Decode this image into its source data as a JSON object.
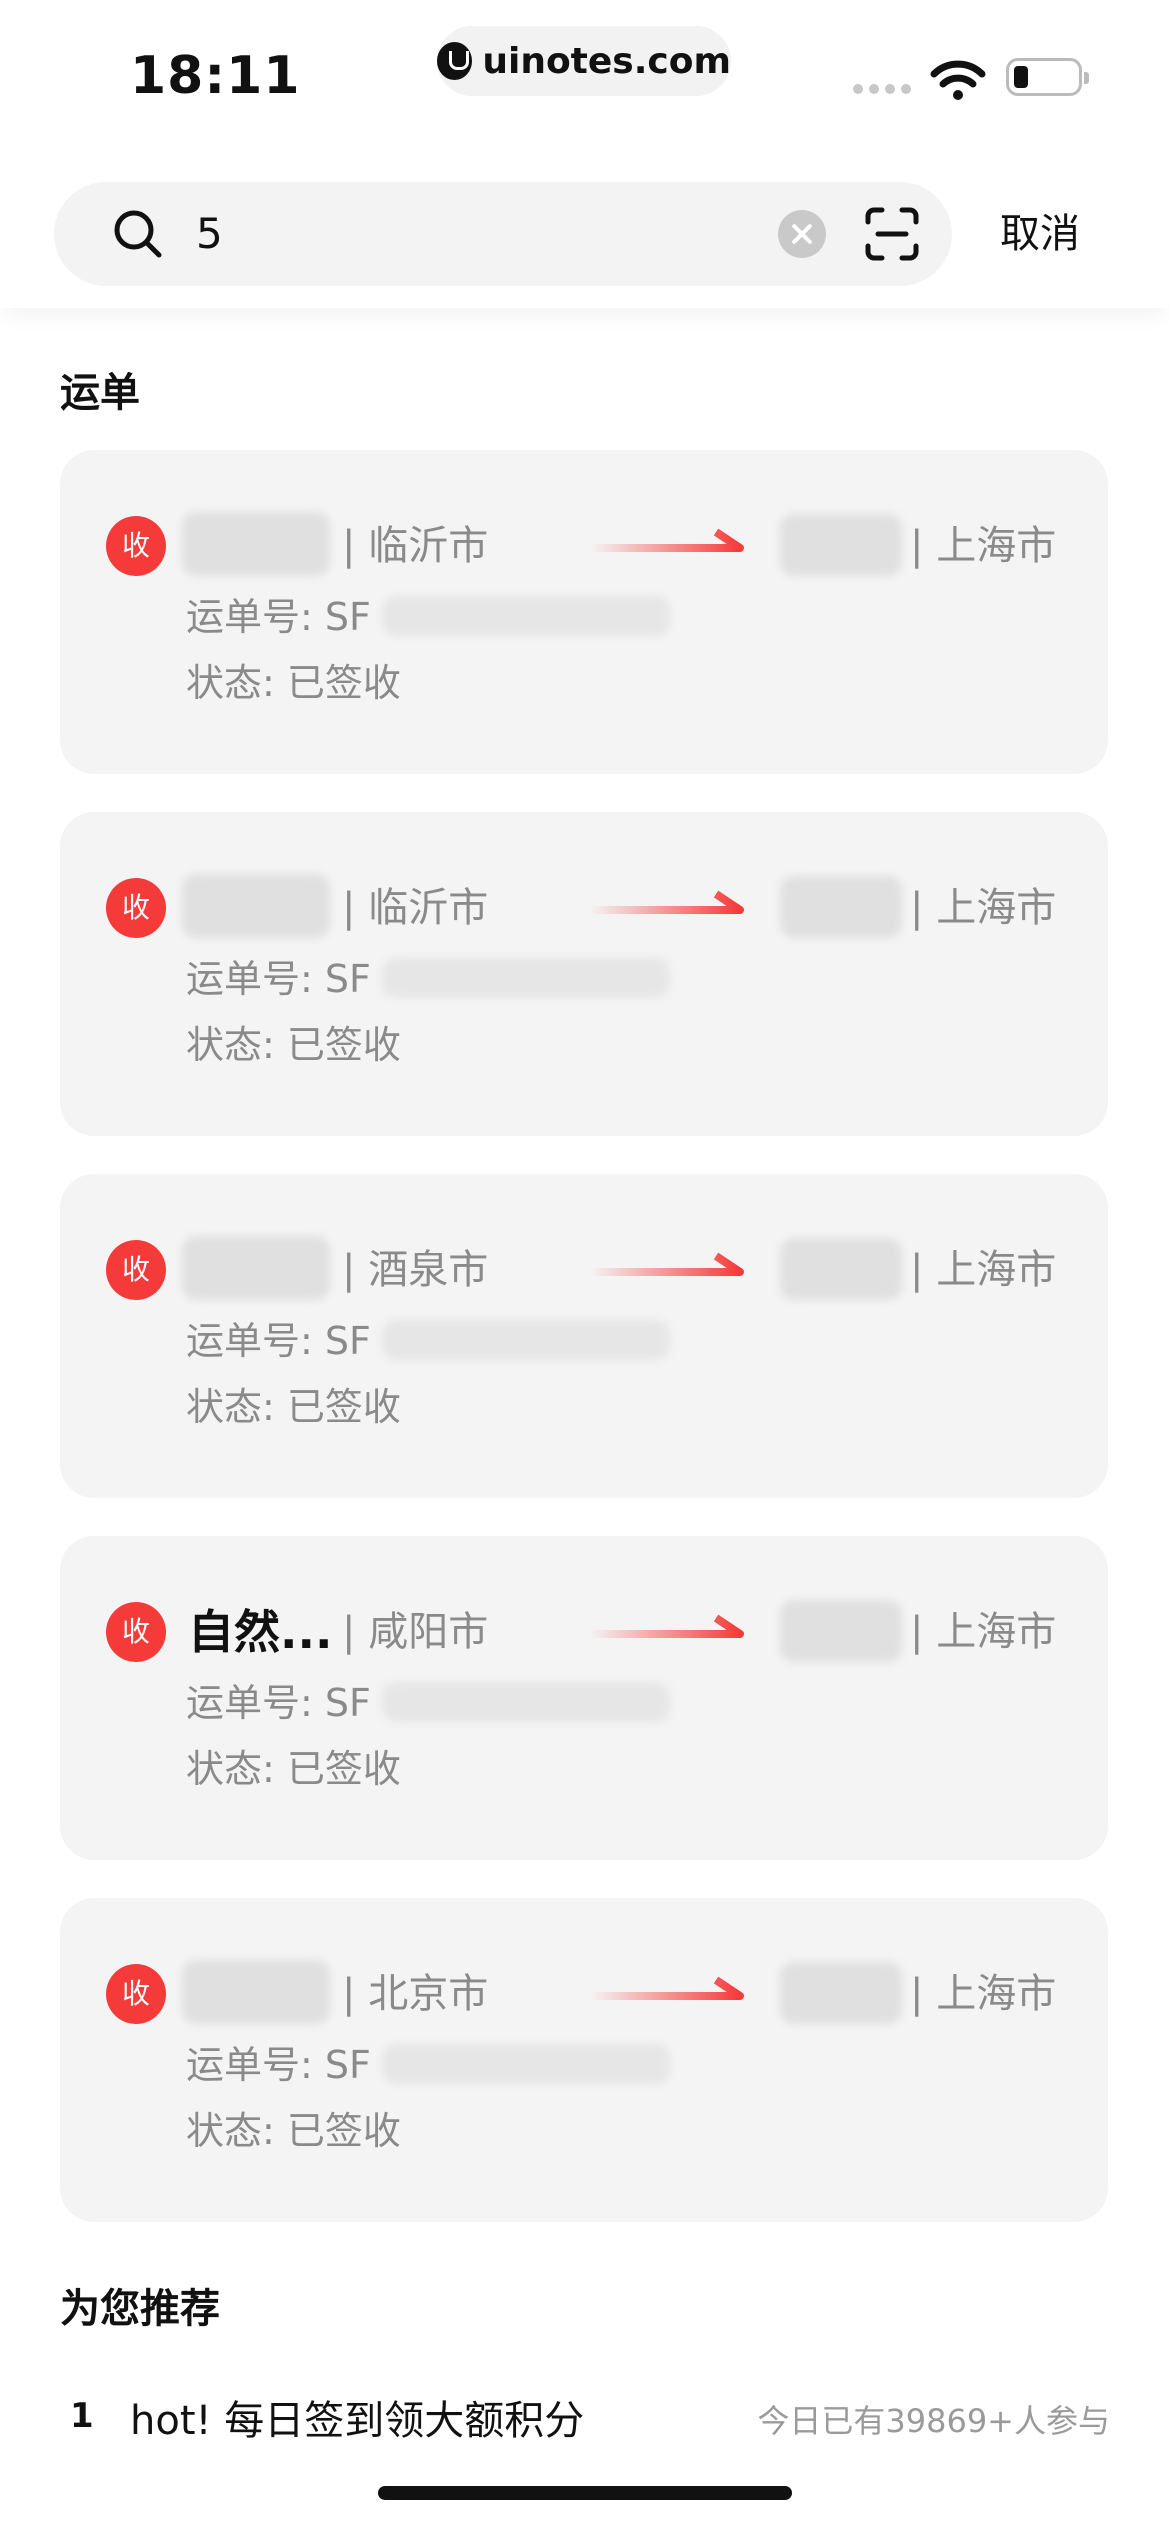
{
  "status_bar": {
    "time": "18:11",
    "url": "uinotes.com"
  },
  "search": {
    "query": "5",
    "cancel_label": "取消"
  },
  "sections": {
    "waybill_title": "运单",
    "recommend_title": "为您推荐"
  },
  "waybills": [
    {
      "badge": "收",
      "sender_name": "",
      "sender_city": "| 临沂市",
      "receiver_city": "| 上海市",
      "waybill_no": "运单号: SF",
      "status": "状态:  已签收"
    },
    {
      "badge": "收",
      "sender_name": "",
      "sender_city": "| 临沂市",
      "receiver_city": "| 上海市",
      "waybill_no": "运单号: SF",
      "status": "状态:  已签收"
    },
    {
      "badge": "收",
      "sender_name": "",
      "sender_city": "| 酒泉市",
      "receiver_city": "| 上海市",
      "waybill_no": "运单号: SF",
      "status": "状态:  已签收"
    },
    {
      "badge": "收",
      "sender_name": "自然...",
      "sender_city": "| 咸阳市",
      "receiver_city": "| 上海市",
      "waybill_no": "运单号: SF",
      "status": "状态:  已签收"
    },
    {
      "badge": "收",
      "sender_name": "",
      "sender_city": "| 北京市",
      "receiver_city": "| 上海市",
      "waybill_no": "运单号: SF",
      "status": "状态:  已签收"
    }
  ],
  "recommend": [
    {
      "index": "1",
      "text": "hot! 每日签到领大额积分",
      "meta": "今日已有39869+人参与"
    }
  ],
  "colors": {
    "accent": "#f53a3a",
    "card_bg": "#f4f4f4",
    "muted_text": "#8a8a8a"
  }
}
